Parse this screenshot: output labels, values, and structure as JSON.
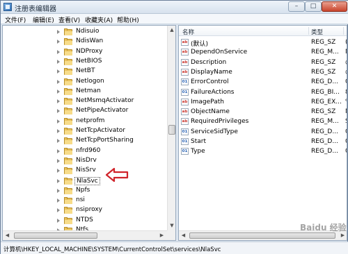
{
  "window": {
    "title": "注册表编辑器",
    "min_label": "–",
    "max_label": "□",
    "close_label": "✕"
  },
  "menu": [
    "文件(F)",
    "编辑(E)",
    "查看(V)",
    "收藏夹(A)",
    "帮助(H)"
  ],
  "tree": {
    "items": [
      {
        "label": "Ndisuio"
      },
      {
        "label": "NdisWan"
      },
      {
        "label": "NDProxy"
      },
      {
        "label": "NetBIOS"
      },
      {
        "label": "NetBT"
      },
      {
        "label": "Netlogon"
      },
      {
        "label": "Netman"
      },
      {
        "label": "NetMsmqActivator"
      },
      {
        "label": "NetPipeActivator"
      },
      {
        "label": "netprofm"
      },
      {
        "label": "NetTcpActivator"
      },
      {
        "label": "NetTcpPortSharing"
      },
      {
        "label": "nfrd960"
      },
      {
        "label": "NisDrv"
      },
      {
        "label": "NisSrv"
      },
      {
        "label": "NlaSvc",
        "selected": true
      },
      {
        "label": "Npfs"
      },
      {
        "label": "nsi"
      },
      {
        "label": "nsiproxy"
      },
      {
        "label": "NTDS"
      },
      {
        "label": "Ntfs"
      }
    ]
  },
  "values": {
    "columns": {
      "name": "名称",
      "type": "类型"
    },
    "rows": [
      {
        "icon": "sz",
        "name": "(默认)",
        "type": "REG_SZ",
        "extra": "("
      },
      {
        "icon": "sz",
        "name": "DependOnService",
        "type": "REG_M...",
        "extra": "N"
      },
      {
        "icon": "sz",
        "name": "Description",
        "type": "REG_SZ",
        "extra": "@"
      },
      {
        "icon": "sz",
        "name": "DisplayName",
        "type": "REG_SZ",
        "extra": "@"
      },
      {
        "icon": "bin",
        "name": "ErrorControl",
        "type": "REG_D...",
        "extra": "0"
      },
      {
        "icon": "bin",
        "name": "FailureActions",
        "type": "REG_BI...",
        "extra": "8"
      },
      {
        "icon": "sz",
        "name": "ImagePath",
        "type": "REG_EX...",
        "extra": "%"
      },
      {
        "icon": "sz",
        "name": "ObjectName",
        "type": "REG_SZ",
        "extra": "N"
      },
      {
        "icon": "sz",
        "name": "RequiredPrivileges",
        "type": "REG_M...",
        "extra": "S"
      },
      {
        "icon": "bin",
        "name": "ServiceSidType",
        "type": "REG_D...",
        "extra": "0"
      },
      {
        "icon": "bin",
        "name": "Start",
        "type": "REG_D...",
        "extra": "0"
      },
      {
        "icon": "bin",
        "name": "Type",
        "type": "REG_D...",
        "extra": "0"
      }
    ]
  },
  "status": {
    "path": "计算机\\HKEY_LOCAL_MACHINE\\SYSTEM\\CurrentControlSet\\services\\NlaSvc"
  },
  "watermark": "Baidu 经验",
  "colors": {
    "arrow": "#d0232a"
  }
}
